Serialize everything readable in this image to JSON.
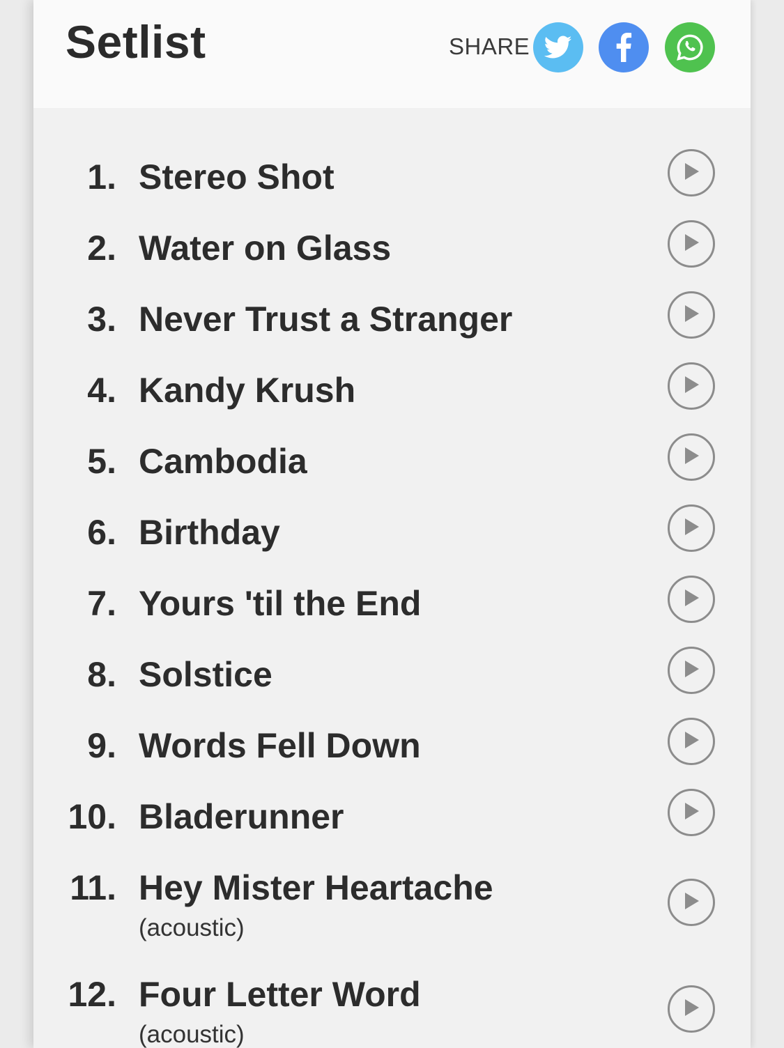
{
  "header": {
    "title": "Setlist",
    "share_label": "SHARE",
    "share_buttons": [
      {
        "name": "twitter",
        "icon": "twitter-icon",
        "color": "#5bbdf2"
      },
      {
        "name": "facebook",
        "icon": "facebook-icon",
        "color": "#4f8ef0"
      },
      {
        "name": "whatsapp",
        "icon": "whatsapp-icon",
        "color": "#4fc24f"
      }
    ]
  },
  "setlist": [
    {
      "num": "1.",
      "title": "Stereo Shot",
      "note": ""
    },
    {
      "num": "2.",
      "title": "Water on Glass",
      "note": ""
    },
    {
      "num": "3.",
      "title": "Never Trust a Stranger",
      "note": ""
    },
    {
      "num": "4.",
      "title": "Kandy Krush",
      "note": ""
    },
    {
      "num": "5.",
      "title": "Cambodia",
      "note": ""
    },
    {
      "num": "6.",
      "title": "Birthday",
      "note": ""
    },
    {
      "num": "7.",
      "title": "Yours 'til the End",
      "note": ""
    },
    {
      "num": "8.",
      "title": "Solstice",
      "note": ""
    },
    {
      "num": "9.",
      "title": "Words Fell Down",
      "note": ""
    },
    {
      "num": "10.",
      "title": "Bladerunner",
      "note": ""
    },
    {
      "num": "11.",
      "title": "Hey Mister Heartache",
      "note": "(acoustic)"
    },
    {
      "num": "12.",
      "title": "Four Letter Word",
      "note": "(acoustic)"
    }
  ],
  "play_icon": "play-circle-icon",
  "colors": {
    "text": "#2c2c2c",
    "play_outline": "#8c8c8c",
    "header_bg": "#fafafa",
    "list_bg": "#f1f1f1"
  }
}
